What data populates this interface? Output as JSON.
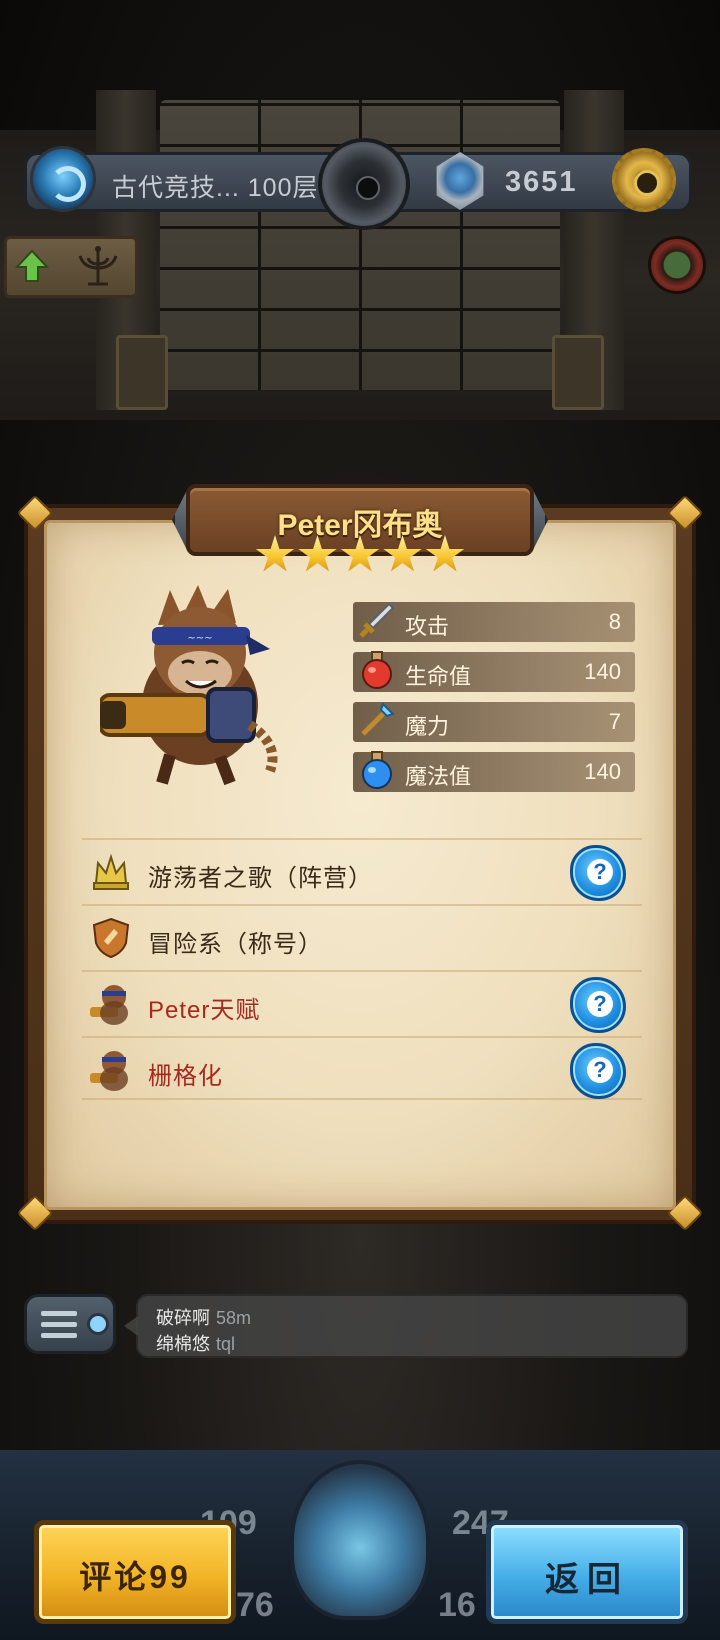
{
  "topbar": {
    "floor_label": "古代竞技... 100层",
    "coins": "3651",
    "icons": [
      "portal-icon",
      "gem-icon",
      "gear-icon"
    ]
  },
  "hero": {
    "name": "Peter冈布奥",
    "stars": 5,
    "stats": [
      {
        "icon": "sword-icon",
        "label": "攻击",
        "value": "8"
      },
      {
        "icon": "red-potion-icon",
        "label": "生命值",
        "value": "140"
      },
      {
        "icon": "staff-icon",
        "label": "魔力",
        "value": "7"
      },
      {
        "icon": "blue-potion-icon",
        "label": "魔法值",
        "value": "140"
      }
    ],
    "traits": [
      {
        "icon": "crown-icon",
        "label": "游荡者之歌（阵营）",
        "help": "?",
        "highlight": false
      },
      {
        "icon": "shield-badge-icon",
        "label": "冒险系（称号）",
        "help": null,
        "highlight": false
      },
      {
        "icon": "hero-talent-icon",
        "label": "Peter天赋",
        "help": "?",
        "highlight": true
      },
      {
        "icon": "hero-skill-icon",
        "label": "栅格化",
        "help": "?",
        "highlight": true
      }
    ]
  },
  "chat": {
    "messages": [
      {
        "user": "破碎啊",
        "text": "58m"
      },
      {
        "user": "绵棉悠",
        "text": "tql"
      }
    ]
  },
  "background_numbers": [
    "109",
    "247",
    "76",
    "16"
  ],
  "buttons": {
    "comment": "评论99",
    "back": "返回"
  },
  "colors": {
    "comment_button": "#f2b426",
    "back_button": "#45aee8",
    "trait_highlight": "#a52a1f",
    "hero_name": "#ffe08a"
  }
}
